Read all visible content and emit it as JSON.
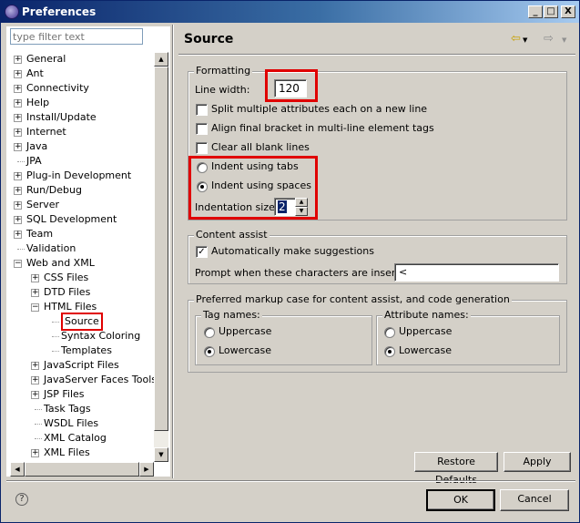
{
  "window": {
    "title": "Preferences",
    "minimize": "_",
    "maximize": "□",
    "close": "X"
  },
  "filter": {
    "placeholder": "type filter text"
  },
  "tree": {
    "items": [
      {
        "label": "General",
        "expandable": true,
        "expanded": false
      },
      {
        "label": "Ant",
        "expandable": true,
        "expanded": false
      },
      {
        "label": "Connectivity",
        "expandable": true,
        "expanded": false
      },
      {
        "label": "Help",
        "expandable": true,
        "expanded": false
      },
      {
        "label": "Install/Update",
        "expandable": true,
        "expanded": false
      },
      {
        "label": "Internet",
        "expandable": true,
        "expanded": false
      },
      {
        "label": "Java",
        "expandable": true,
        "expanded": false
      },
      {
        "label": "JPA",
        "expandable": false
      },
      {
        "label": "Plug-in Development",
        "expandable": true,
        "expanded": false
      },
      {
        "label": "Run/Debug",
        "expandable": true,
        "expanded": false
      },
      {
        "label": "Server",
        "expandable": true,
        "expanded": false
      },
      {
        "label": "SQL Development",
        "expandable": true,
        "expanded": false
      },
      {
        "label": "Team",
        "expandable": true,
        "expanded": false
      },
      {
        "label": "Validation",
        "expandable": false
      },
      {
        "label": "Web and XML",
        "expandable": true,
        "expanded": true
      },
      {
        "label": "CSS Files",
        "expandable": true,
        "expanded": false
      },
      {
        "label": "DTD Files",
        "expandable": true,
        "expanded": false
      },
      {
        "label": "HTML Files",
        "expandable": true,
        "expanded": true
      },
      {
        "label": "Source",
        "expandable": false,
        "selected": true
      },
      {
        "label": "Syntax Coloring",
        "expandable": false
      },
      {
        "label": "Templates",
        "expandable": false
      },
      {
        "label": "JavaScript Files",
        "expandable": true,
        "expanded": false
      },
      {
        "label": "JavaServer Faces Tools",
        "expandable": true,
        "expanded": false
      },
      {
        "label": "JSP Files",
        "expandable": true,
        "expanded": false
      },
      {
        "label": "Task Tags",
        "expandable": false
      },
      {
        "label": "WSDL Files",
        "expandable": false
      },
      {
        "label": "XML Catalog",
        "expandable": false
      },
      {
        "label": "XML Files",
        "expandable": true,
        "expanded": false
      }
    ]
  },
  "page": {
    "title": "Source",
    "back_icon": "back-arrow-icon",
    "forward_icon": "forward-arrow-icon",
    "formatting": {
      "label": "Formatting",
      "line_width_label": "Line width:",
      "line_width_value": "120",
      "split_attributes": {
        "label": "Split multiple attributes each on a new line",
        "checked": false
      },
      "align_bracket": {
        "label": "Align final bracket in multi-line element tags",
        "checked": false
      },
      "clear_blank": {
        "label": "Clear all blank lines",
        "checked": false
      },
      "indent_tabs": {
        "label": "Indent using tabs",
        "selected": false
      },
      "indent_spaces": {
        "label": "Indent using spaces",
        "selected": true
      },
      "indent_size_label": "Indentation size:",
      "indent_size_value": "2"
    },
    "content_assist": {
      "label": "Content assist",
      "auto_suggest": {
        "label": "Automatically make suggestions",
        "checked": true
      },
      "prompt_label": "Prompt when these characters are inserted:",
      "prompt_value": "<"
    },
    "markup_case": {
      "label": "Preferred markup case for content assist, and code generation",
      "tag_names": {
        "label": "Tag names:",
        "uppercase": "Uppercase",
        "lowercase": "Lowercase",
        "selected": "Lowercase"
      },
      "attribute_names": {
        "label": "Attribute names:",
        "uppercase": "Uppercase",
        "lowercase": "Lowercase",
        "selected": "Lowercase"
      }
    },
    "restore_defaults": "Restore Defaults",
    "apply": "Apply"
  },
  "footer": {
    "help": "?",
    "ok": "OK",
    "cancel": "Cancel"
  },
  "colors": {
    "titlebar_start": "#0a246a",
    "titlebar_end": "#a6caf0",
    "highlight_box": "#e00000",
    "dialog_bg": "#d4d0c8"
  }
}
